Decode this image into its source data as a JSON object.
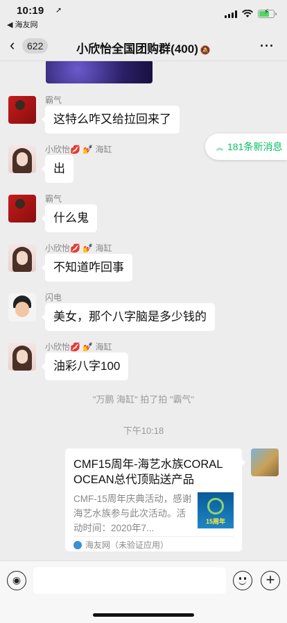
{
  "status_bar": {
    "time": "10:19",
    "back_app": "◀ 海友网"
  },
  "nav": {
    "unread_count": "622",
    "title": "小欣怡全国团购群(400)"
  },
  "new_messages": "181条新消息",
  "messages": [
    {
      "sender": "霸气",
      "text": "这特么咋又给拉回来了"
    },
    {
      "sender": "小欣怡💋 💅 海缸",
      "text": "出"
    },
    {
      "sender": "霸气",
      "text": "什么鬼"
    },
    {
      "sender": "小欣怡💋 💅 海缸",
      "text": "不知道咋回事"
    },
    {
      "sender": "闪电",
      "text": "美女，那个八字脑是多少钱的"
    },
    {
      "sender": "小欣怡💋 💅 海缸",
      "text": "油彩八字100"
    }
  ],
  "system_pat": "\"万鹏 海缸\" 拍了拍 \"霸气\"",
  "timestamp": "下午10:18",
  "link_card": {
    "title": "CMF15周年-海艺水族CORAL OCEAN总代顶贴送产品",
    "description": "CMF-15周年庆典活动，感谢海艺水族参与此次活动。活动时间：2020年7...",
    "source": "海友网（未验证应用）",
    "thumb_label": "15周年"
  },
  "input": {
    "placeholder": ""
  }
}
